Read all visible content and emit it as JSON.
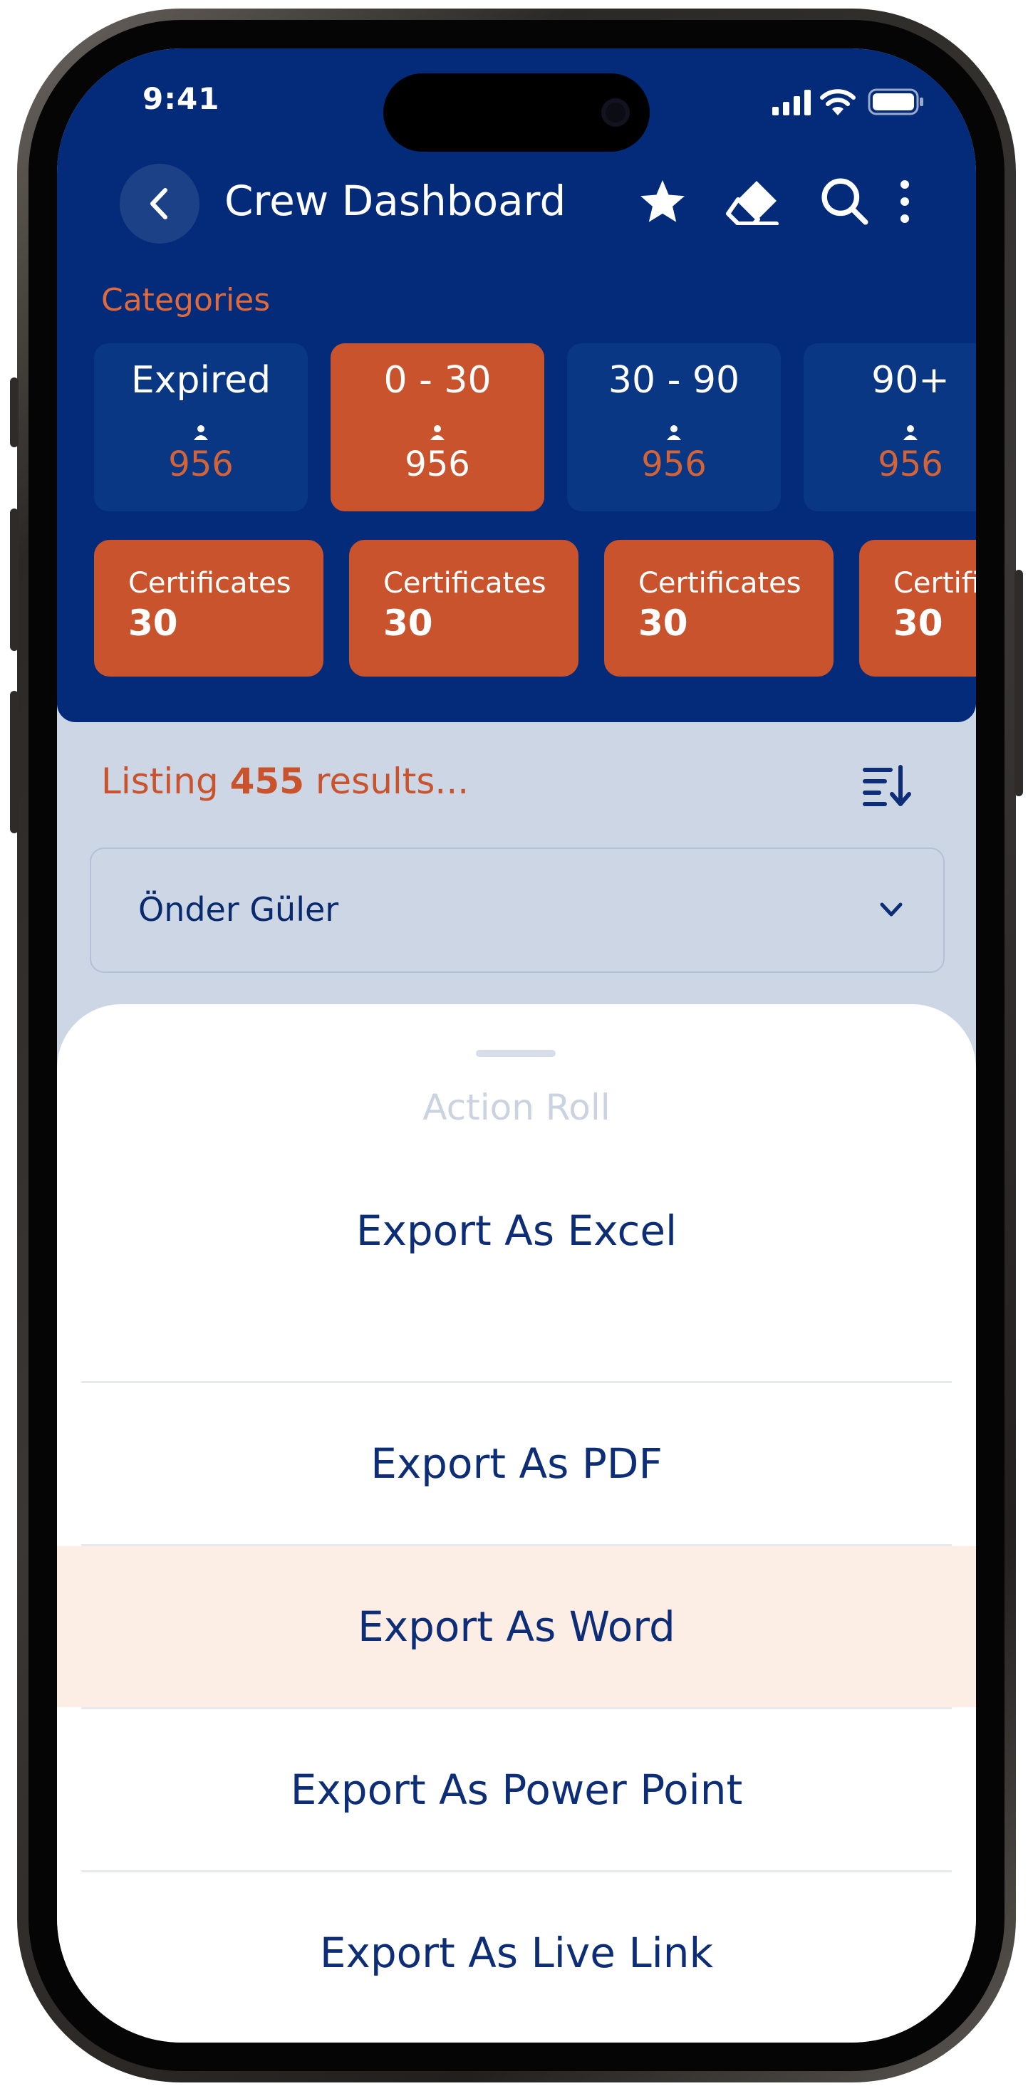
{
  "status_bar": {
    "time": "9:41"
  },
  "header": {
    "title": "Crew Dashboard",
    "icons": [
      "back-chevron-icon",
      "star-icon",
      "eraser-icon",
      "search-icon",
      "more-vertical-icon"
    ]
  },
  "categories": {
    "label": "Categories",
    "items": [
      {
        "name": "Expired",
        "count": "956"
      },
      {
        "name": "0 - 30",
        "count": "956",
        "selected": true
      },
      {
        "name": "30 - 90",
        "count": "956"
      },
      {
        "name": "90+",
        "count": "956"
      }
    ]
  },
  "certificates": [
    {
      "label": "Certificates",
      "value": "30"
    },
    {
      "label": "Certificates",
      "value": "30"
    },
    {
      "label": "Certificates",
      "value": "30"
    },
    {
      "label": "Certificates",
      "value": "30"
    }
  ],
  "listing": {
    "prefix": "Listing",
    "count": "455",
    "suffix": "results..."
  },
  "filter": {
    "selected": "Önder Güler"
  },
  "action_sheet": {
    "title": "Action Roll",
    "items": [
      "Export As Excel",
      "Export As PDF",
      "Export As Word",
      "Export As Power Point",
      "Export As Live Link"
    ],
    "highlighted": "Export As Word"
  },
  "colors": {
    "primary": "#032b7a",
    "accent": "#c9532d",
    "background": "#ccd6e5",
    "highlight": "#fcede5"
  }
}
